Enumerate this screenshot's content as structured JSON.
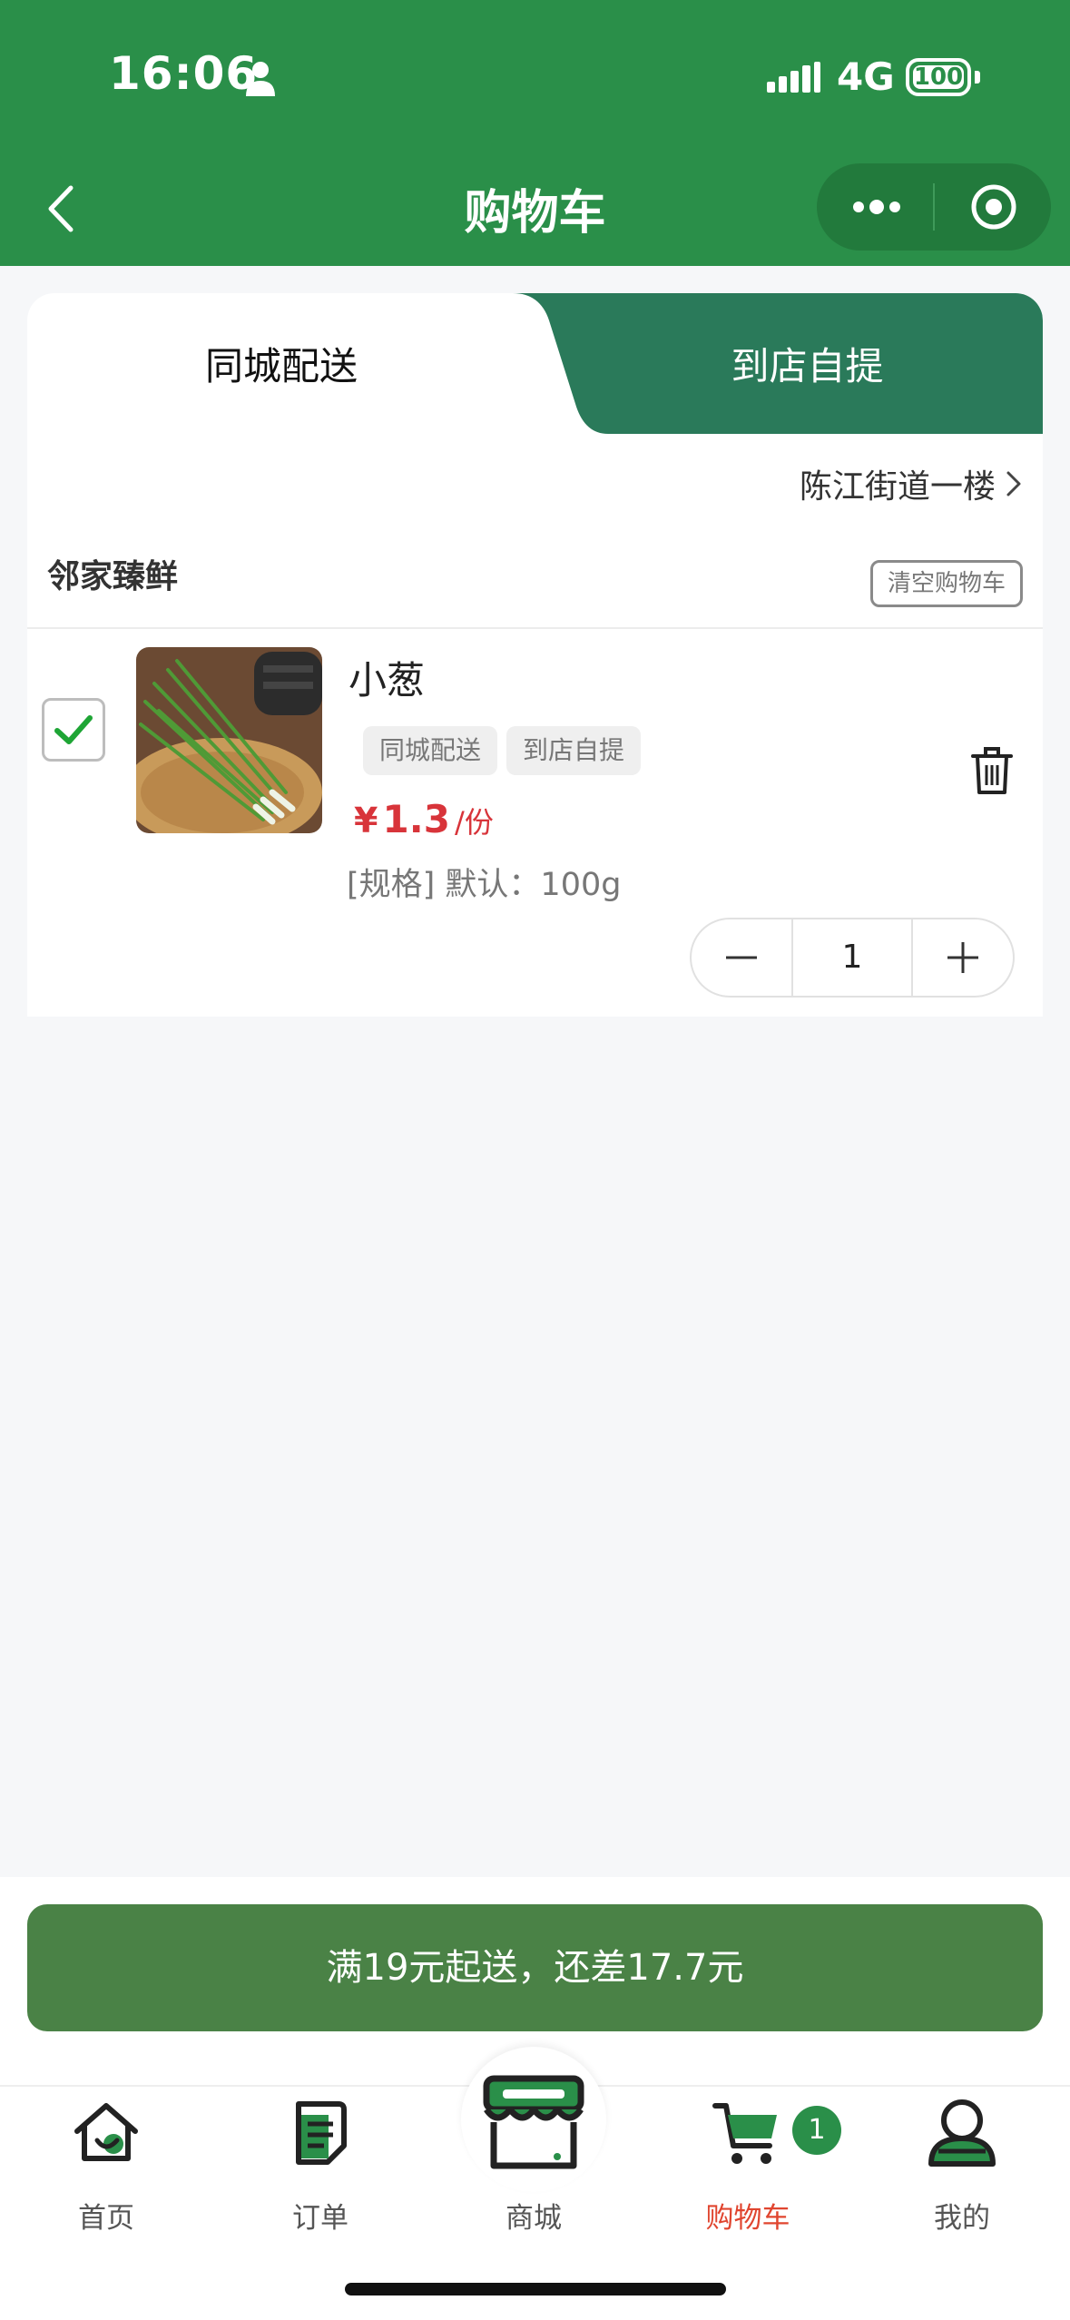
{
  "status_bar": {
    "time": "16:06",
    "network": "4G",
    "battery": "100"
  },
  "header": {
    "title": "购物车"
  },
  "delivery_tabs": {
    "active": "同城配送",
    "inactive": "到店自提"
  },
  "address": "陈江街道一楼",
  "shop": {
    "name": "邻家臻鲜",
    "clear_label": "清空购物车"
  },
  "cart_item": {
    "name": "小葱",
    "tags": [
      "同城配送",
      "到店自提"
    ],
    "price_symbol": "¥",
    "price": "1.3",
    "unit": "/份",
    "spec": "[规格] 默认：100g",
    "quantity": "1",
    "checked": true
  },
  "checkout": {
    "label": "满19元起送，还差17.7元"
  },
  "tab_bar": {
    "items": [
      {
        "label": "首页",
        "icon": "home-icon"
      },
      {
        "label": "订单",
        "icon": "order-icon"
      },
      {
        "label": "商城",
        "icon": "store-icon"
      },
      {
        "label": "购物车",
        "icon": "cart-icon",
        "active": true,
        "badge": "1"
      },
      {
        "label": "我的",
        "icon": "user-icon"
      }
    ]
  },
  "colors": {
    "brand_green": "#2a8f49",
    "checkout_green": "#4a8246",
    "price_red": "#d8343a",
    "active_tab": "#e0452f"
  }
}
